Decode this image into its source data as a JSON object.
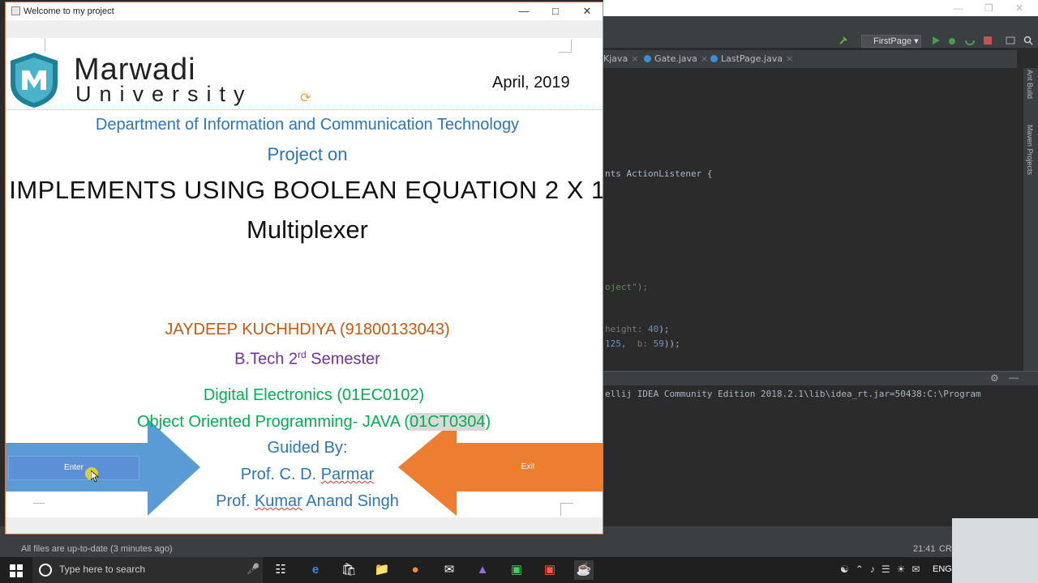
{
  "window": {
    "title": "Welcome to my project",
    "minimize": "—",
    "maximize": "□",
    "close": "✕"
  },
  "slide": {
    "brand_line1": "Marwadi",
    "brand_line2": "University",
    "date": "April, 2019",
    "department": "Department of Information and Communication Technology",
    "project_on": "Project on",
    "title_line1": "IMPLEMENTS USING BOOLEAN EQUATION 2 X 1",
    "title_line2": "Multiplexer",
    "student": "JAYDEEP KUCHHDIYA (91800133043)",
    "semester_prefix": "B.Tech 2",
    "semester_sup": "rd",
    "semester_suffix": " Semester",
    "course1": "Digital Electronics  (01EC0102)",
    "course2_prefix": "Object Oriented Programming- JAVA (",
    "course2_code": "01CT0304",
    "course2_suffix": ")",
    "guided_by": "Guided By:",
    "prof1_prefix": "Prof. C. D. ",
    "prof1_surname": "Parmar",
    "prof2_prefix": "Prof. ",
    "prof2_first": "Kumar",
    "prof2_rest": " Anand Singh",
    "enter_label": "Enter",
    "exit_label": "Exit"
  },
  "colors": {
    "blue_arrow": "#5b9bd5",
    "orange_arrow": "#ed7d31",
    "green_text": "#00b050",
    "orange_text": "#c55a11",
    "purple_text": "#7030a0",
    "blue_text": "#2e75b6"
  },
  "ide": {
    "run_config": "FirstPage",
    "tabs": [
      "Kjava",
      "Gate.java",
      "LastPage.java"
    ],
    "code_line1": "nts ActionListener {",
    "code_line2_str": "oject\");",
    "code_line3_hint": "height:",
    "code_line3_num": "40",
    "code_line3_end": ");",
    "code_line4_num1": "125,",
    "code_line4_hint": "b:",
    "code_line4_num2": "59",
    "code_line4_end": "));",
    "console": "ellij IDEA Community Edition 2018.2.1\\lib\\idea_rt.jar=50438:C:\\Program",
    "side_label1": "Ant Build",
    "side_label2": "Maven Projects",
    "status_text": "All files are up-to-date (3 minutes ago)",
    "status_time": "21:41",
    "status_crlf": "CRL"
  },
  "taskbar": {
    "search_placeholder": "Type here to search",
    "language": "ENG"
  }
}
